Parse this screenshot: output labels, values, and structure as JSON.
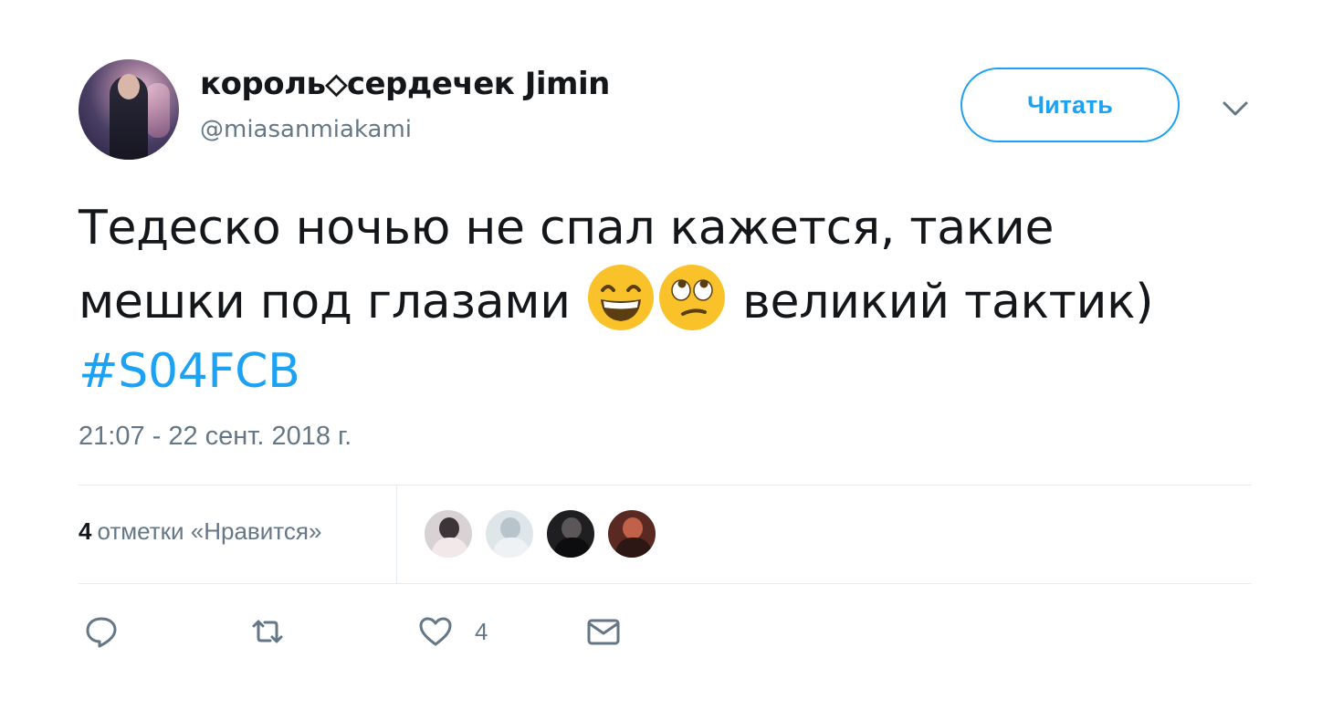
{
  "author": {
    "display_name": "король⬦сердечек Jimin",
    "handle": "@miasanmiakami"
  },
  "follow_button": {
    "label": "Читать"
  },
  "tweet": {
    "text_line1": "Тедеско ночью не спал кажется, такие",
    "text_line2_before": "мешки под глазами ",
    "text_line2_after": " великий тактик)",
    "emojis": [
      "grinning-squinting-face",
      "face-with-rolling-eyes"
    ],
    "hashtag": "#S04FCB",
    "timestamp": "21:07 - 22 сент. 2018 г."
  },
  "stats": {
    "likes_count": "4",
    "likes_label": "отметки «Нравится»",
    "liker_avatars": 4
  },
  "actions": {
    "reply_icon": "reply-icon",
    "retweet_icon": "retweet-icon",
    "like_icon": "heart-icon",
    "like_count": "4",
    "dm_icon": "envelope-icon"
  },
  "colors": {
    "accent": "#1da1f2",
    "secondary_text": "#657786",
    "primary_text": "#14171a",
    "divider": "#e6ecf0"
  }
}
